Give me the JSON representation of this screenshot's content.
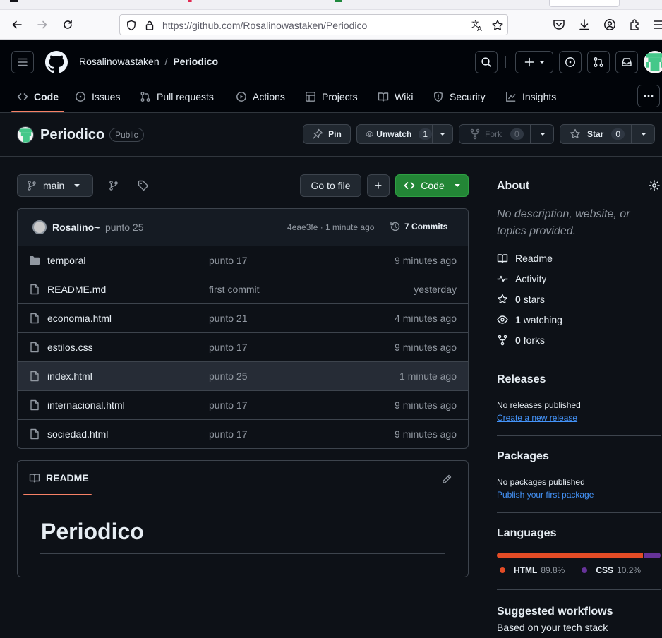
{
  "browser": {
    "url_domain": "https://github.com",
    "url_path": "/Rosalinowastaken/Periodico"
  },
  "header": {
    "owner": "Rosalinowastaken",
    "separator": "/",
    "repo": "Periodico"
  },
  "tabs": [
    {
      "label": "Code",
      "icon": "code-icon",
      "selected": true
    },
    {
      "label": "Issues",
      "icon": "issue-icon"
    },
    {
      "label": "Pull requests",
      "icon": "pull-request-icon"
    },
    {
      "label": "Actions",
      "icon": "play-icon"
    },
    {
      "label": "Projects",
      "icon": "table-icon"
    },
    {
      "label": "Wiki",
      "icon": "book-icon"
    },
    {
      "label": "Security",
      "icon": "shield-icon"
    },
    {
      "label": "Insights",
      "icon": "graph-icon"
    }
  ],
  "repo_header": {
    "name": "Periodico",
    "visibility": "Public",
    "pin_label": "Pin",
    "watch_label": "Unwatch",
    "watch_count": "1",
    "fork_label": "Fork",
    "fork_count": "0",
    "star_label": "Star",
    "star_count": "0"
  },
  "toolbar": {
    "branch": "main",
    "go_to_file": "Go to file",
    "add": "+",
    "code_label": "Code"
  },
  "latest_commit": {
    "author": "Rosalino~",
    "message": "punto 25",
    "sha_time": "4eae3fe · 1 minute ago",
    "commits_label": "7 Commits"
  },
  "files": [
    {
      "name": "temporal",
      "type": "dir",
      "message": "punto 17",
      "age": "9 minutes ago"
    },
    {
      "name": "README.md",
      "type": "file",
      "message": "first commit",
      "age": "yesterday"
    },
    {
      "name": "economia.html",
      "type": "file",
      "message": "punto 21",
      "age": "4 minutes ago"
    },
    {
      "name": "estilos.css",
      "type": "file",
      "message": "punto 17",
      "age": "9 minutes ago"
    },
    {
      "name": "index.html",
      "type": "file",
      "message": "punto 25",
      "age": "1 minute ago",
      "hover": true
    },
    {
      "name": "internacional.html",
      "type": "file",
      "message": "punto 17",
      "age": "9 minutes ago"
    },
    {
      "name": "sociedad.html",
      "type": "file",
      "message": "punto 17",
      "age": "9 minutes ago"
    }
  ],
  "readme": {
    "tab_label": "README",
    "heading": "Periodico"
  },
  "about": {
    "title": "About",
    "description": "No description, website, or topics provided.",
    "readme": "Readme",
    "activity": "Activity",
    "stars_count": "0",
    "stars_label": "stars",
    "watching_count": "1",
    "watching_label": "watching",
    "forks_count": "0",
    "forks_label": "forks"
  },
  "releases": {
    "title": "Releases",
    "empty": "No releases published",
    "link": "Create a new release"
  },
  "packages": {
    "title": "Packages",
    "empty": "No packages published",
    "link": "Publish your first package"
  },
  "languages": {
    "title": "Languages",
    "items": [
      {
        "name": "HTML",
        "percent": "89.8%",
        "value": 89.8,
        "color": "#e34c26"
      },
      {
        "name": "CSS",
        "percent": "10.2%",
        "value": 10.2,
        "color": "#663399"
      }
    ]
  },
  "workflows": {
    "title": "Suggested workflows",
    "subtitle": "Based on your tech stack"
  },
  "colors": {
    "accent_green": "#238636",
    "link_blue": "#4493f8",
    "tab_underline": "#f78166"
  }
}
